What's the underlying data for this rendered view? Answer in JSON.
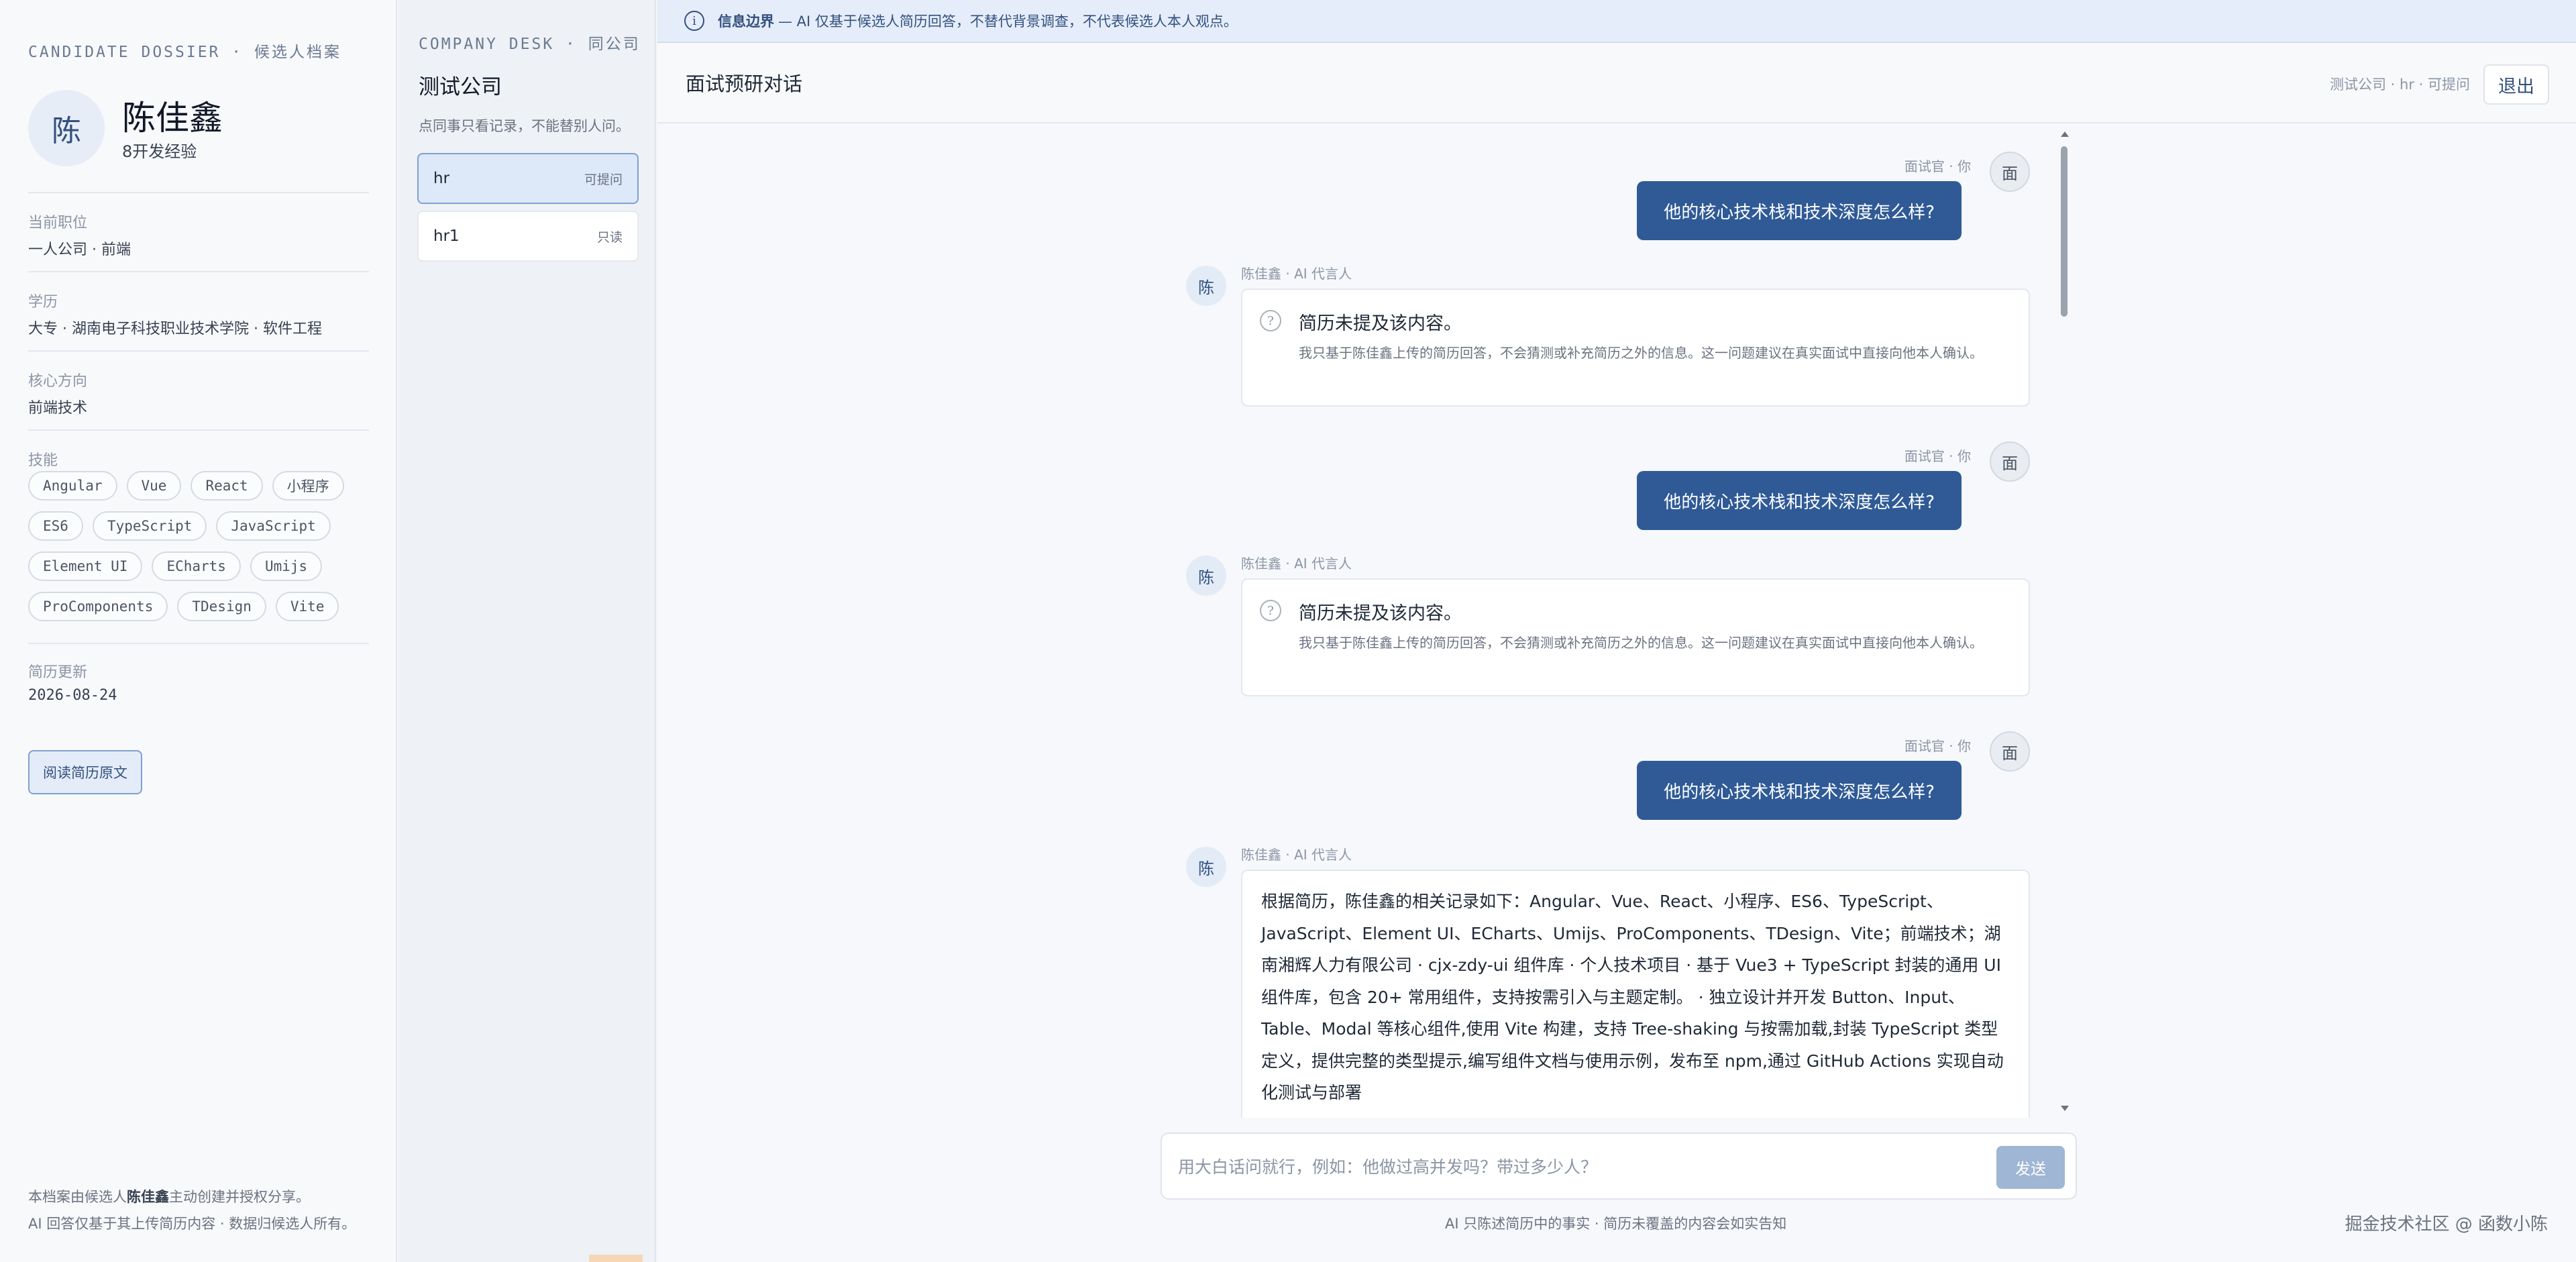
{
  "dossier": {
    "eyebrow": "CANDIDATE DOSSIER · 候选人档案",
    "avatar_char": "陈",
    "name": "陈佳鑫",
    "experience": "8开发经验",
    "position_label": "当前职位",
    "position_value": "一人公司 · 前端",
    "education_label": "学历",
    "education_value": "大专 · 湖南电子科技职业技术学院 · 软件工程",
    "direction_label": "核心方向",
    "direction_value": "前端技术",
    "skills_label": "技能",
    "skills": [
      "Angular",
      "Vue",
      "React",
      "小程序",
      "ES6",
      "TypeScript",
      "JavaScript",
      "Element UI",
      "ECharts",
      "Umijs",
      "ProComponents",
      "TDesign",
      "Vite"
    ],
    "updated_label": "简历更新",
    "updated_value": "2026-08-24",
    "read_button": "阅读简历原文",
    "footnote_1_prefix": "本档案由候选人",
    "footnote_1_name": "陈佳鑫",
    "footnote_1_suffix": "主动创建并授权分享。",
    "footnote_2": "AI 回答仅基于其上传简历内容 · 数据归候选人所有。"
  },
  "desk": {
    "eyebrow": "COMPANY DESK · 同公司",
    "title": "测试公司",
    "note": "点同事只看记录，不能替别人问。",
    "accounts": [
      {
        "name": "hr",
        "perm": "可提问"
      },
      {
        "name": "hr1",
        "perm": "只读"
      }
    ]
  },
  "banner": {
    "bold": "信息边界",
    "text": "— AI 仅基于候选人简历回答，不替代背景调查，不代表候选人本人观点。"
  },
  "topbar": {
    "title": "面试预研对话",
    "status": "测试公司 · hr · 可提问",
    "logout": "退出"
  },
  "messages": {
    "q_meta": "面试官 · 你",
    "q_avatar": "面",
    "a_avatar": "陈",
    "a_meta": "陈佳鑫 · AI 代言人",
    "question": "他的核心技术栈和技术深度怎么样?",
    "unknown_icon": "?",
    "unknown_title": "简历未提及该内容。",
    "unknown_body": "我只基于陈佳鑫上传的简历回答，不会猜测或补充简历之外的信息。这一问题建议在真实面试中直接向他本人确认。",
    "answer": "根据简历，陈佳鑫的相关记录如下：Angular、Vue、React、小程序、ES6、TypeScript、JavaScript、Element UI、ECharts、Umijs、ProComponents、TDesign、Vite；前端技术；湖南湘辉人力有限公司 · cjx-zdy-ui 组件库 · 个人技术项目 · 基于 Vue3 + TypeScript 封装的通用 UI 组件库，包含 20+ 常用组件，支持按需引入与主题定制。 · 独立设计并开发 Button、Input、Table、Modal 等核心组件,使用 Vite 构建，支持 Tree-shaking 与按需加载,封装 TypeScript 类型定义，提供完整的类型提示,编写组件文档与使用示例，发布至 npm,通过 GitHub Actions 实现自动化测试与部署"
  },
  "composer": {
    "placeholder": "用大白话问就行，例如：他做过高并发吗？带过多少人？",
    "send": "发送",
    "note": "AI 只陈述简历中的事实 · 简历未覆盖的内容会如实告知"
  },
  "watermark": "掘金技术社区 @ 函数小陈",
  "icons": {
    "info": "info-icon",
    "unknown": "question-icon"
  }
}
